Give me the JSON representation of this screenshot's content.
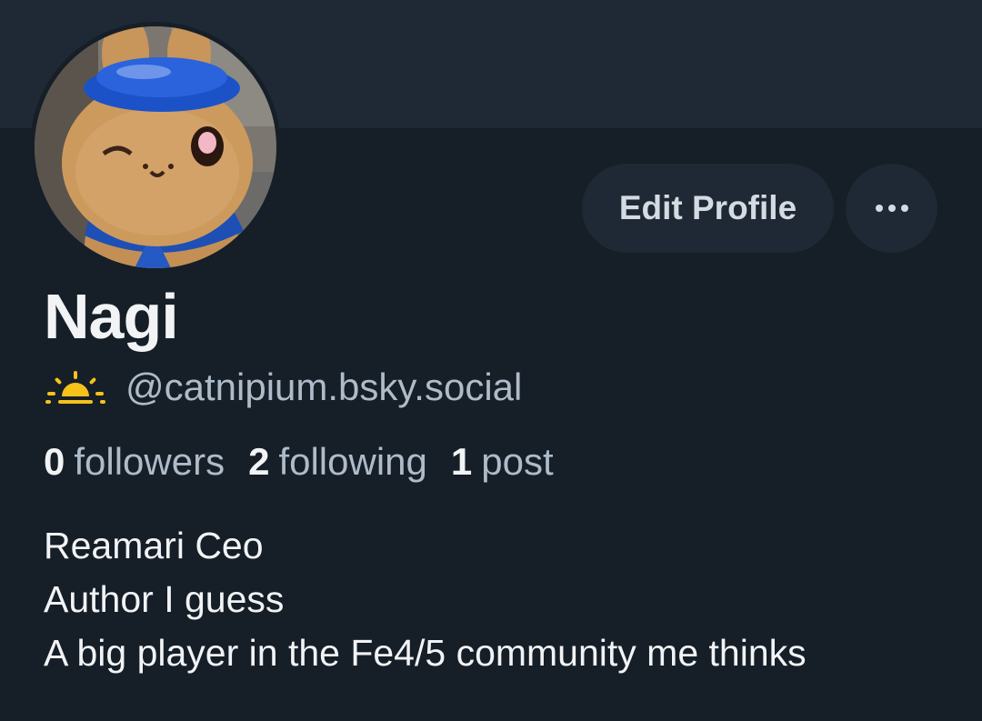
{
  "colors": {
    "background": "#161e27",
    "banner": "#1e2935",
    "button_bg": "#1e2935",
    "text_primary": "#f1f3f5",
    "text_secondary": "#aebbc9",
    "emoji_sun": "#f4c21b"
  },
  "profile": {
    "display_name": "Nagi",
    "handle_emoji_icon": "sunrise-icon",
    "handle": "@catnipium.bsky.social",
    "avatar_icon": "plush-bear-avatar"
  },
  "actions": {
    "edit_label": "Edit Profile",
    "more_icon": "ellipsis-icon"
  },
  "stats": [
    {
      "count": "0",
      "label": "followers"
    },
    {
      "count": "2",
      "label": "following"
    },
    {
      "count": "1",
      "label": "post"
    }
  ],
  "bio": [
    "Reamari Ceo",
    "Author I guess",
    "A big player in the Fe4/5 community me thinks"
  ]
}
